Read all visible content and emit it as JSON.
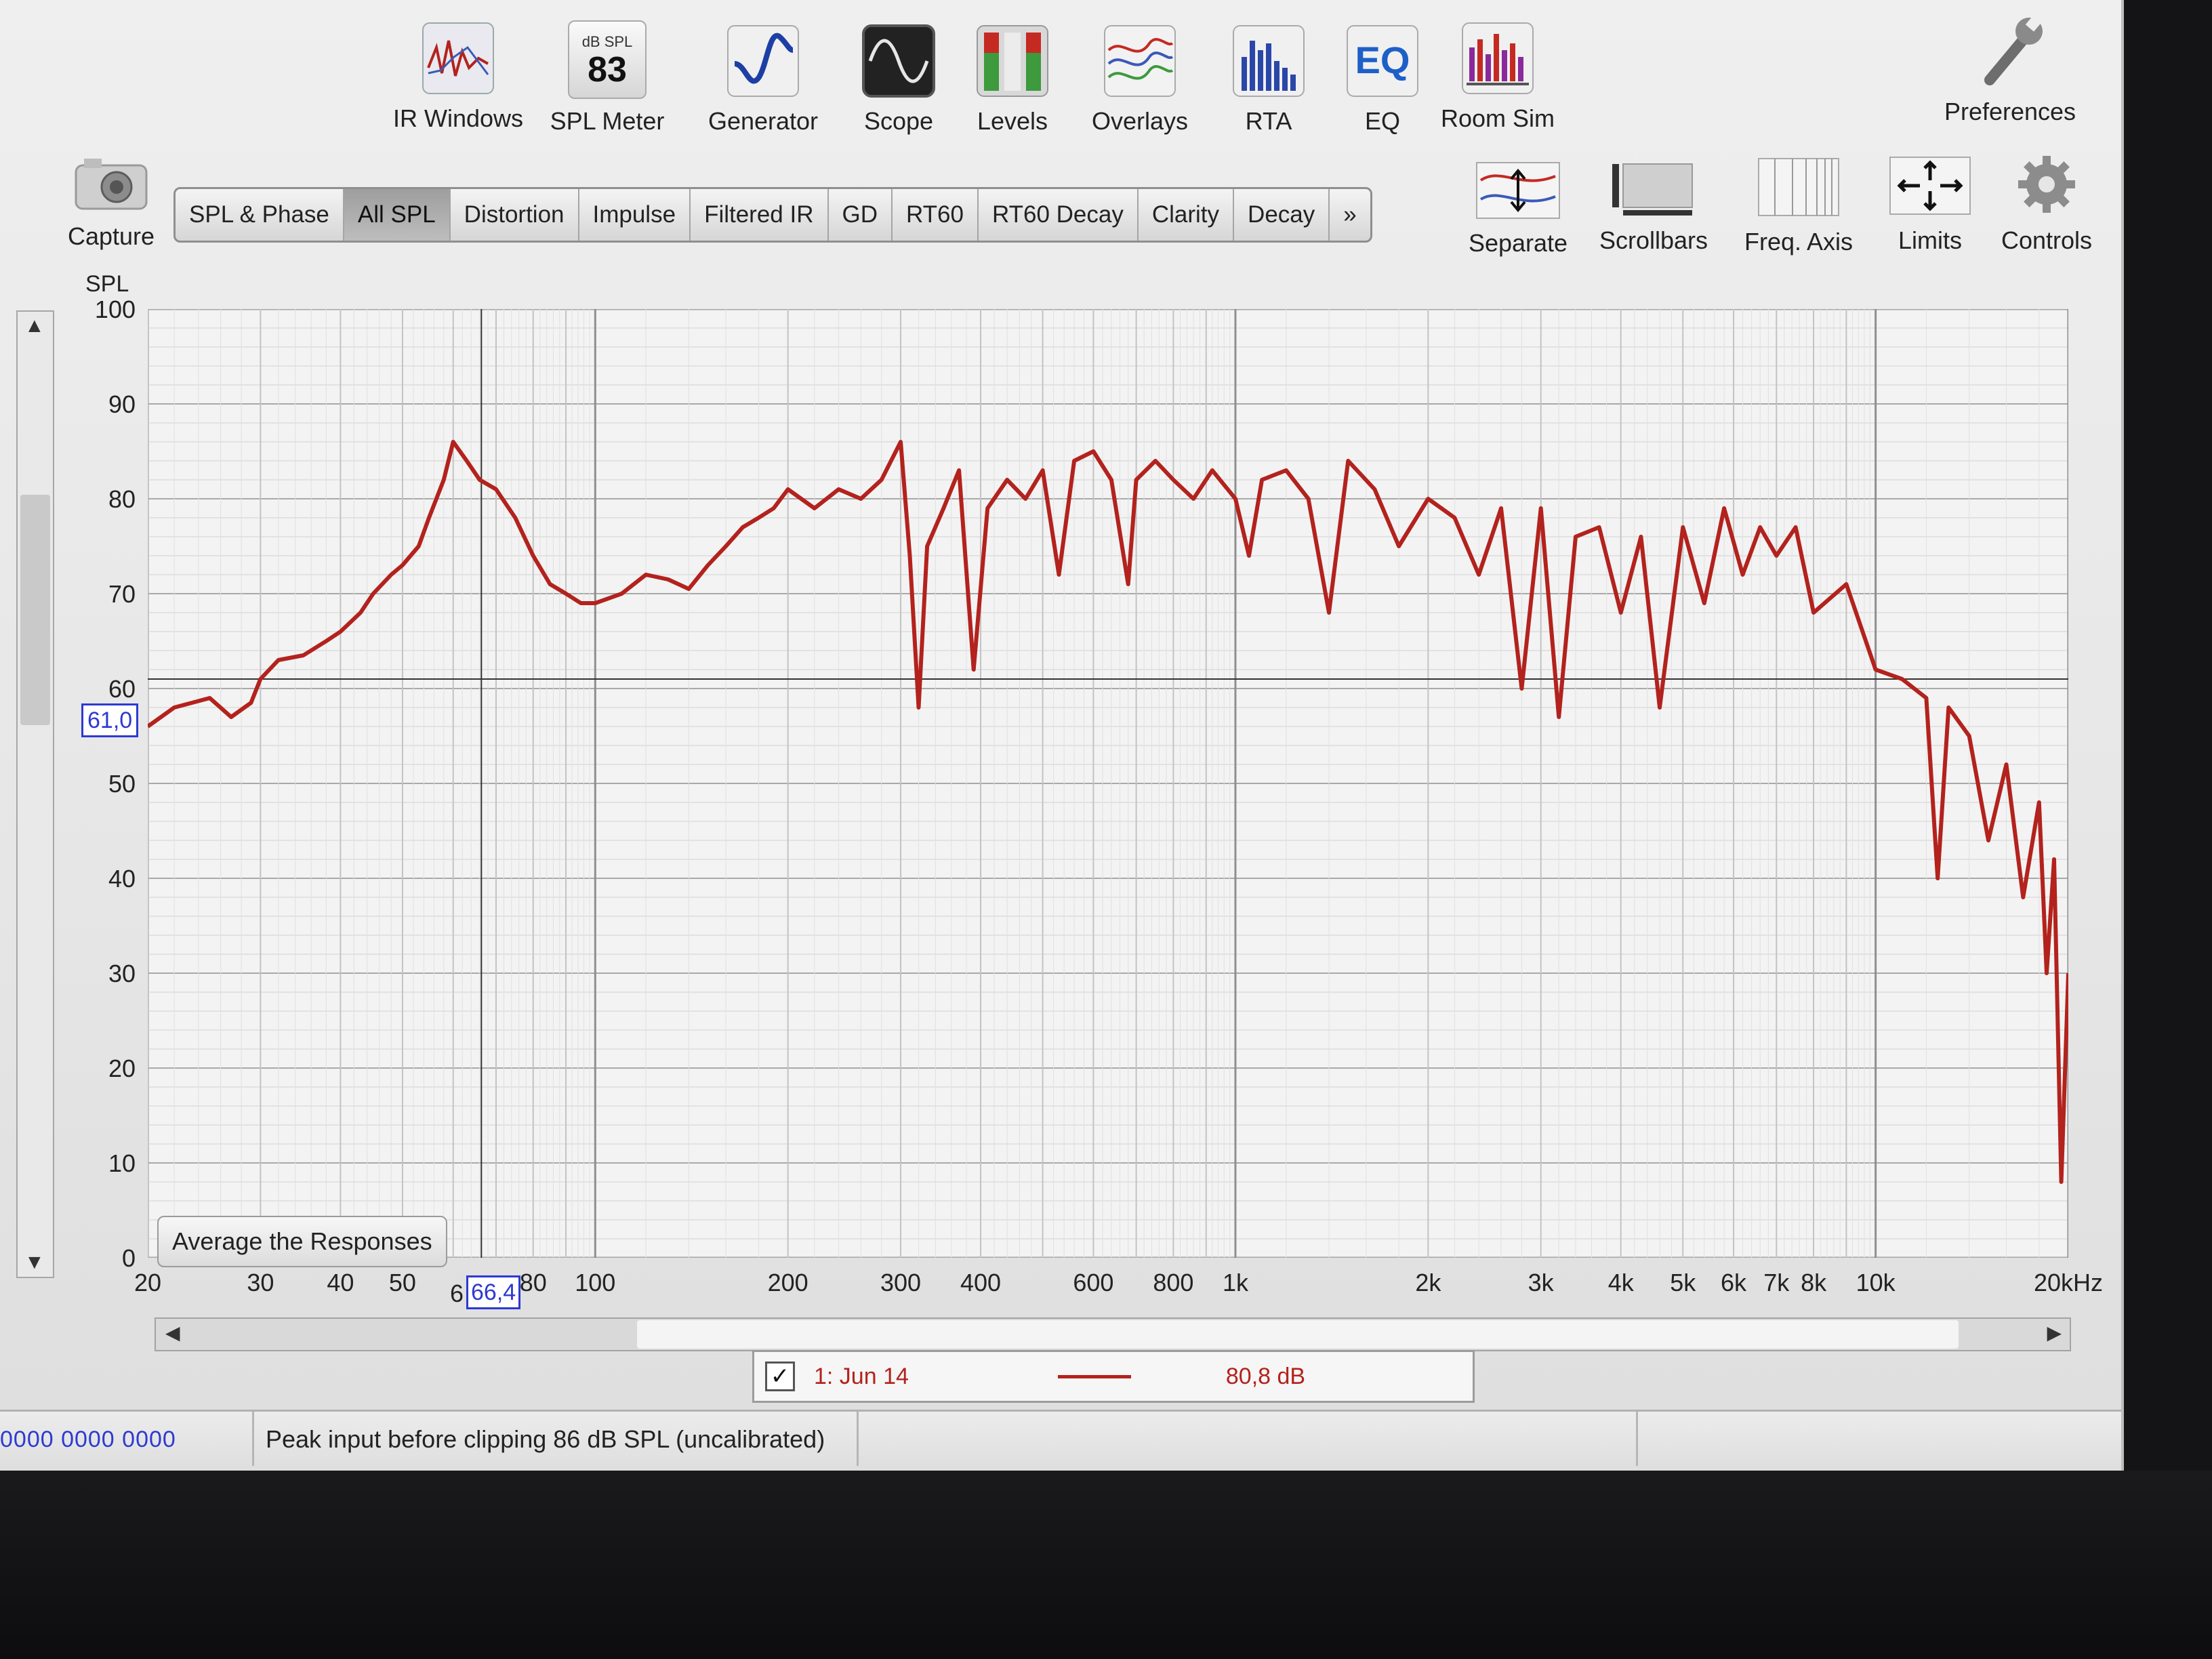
{
  "toolbar": {
    "items": [
      {
        "label": "IR Windows",
        "icon": "ir-windows-icon"
      },
      {
        "label": "SPL Meter",
        "icon": "spl-meter-icon",
        "badge_top": "dB SPL",
        "badge_value": "83"
      },
      {
        "label": "Generator",
        "icon": "generator-icon"
      },
      {
        "label": "Scope",
        "icon": "scope-icon"
      },
      {
        "label": "Levels",
        "icon": "levels-icon"
      },
      {
        "label": "Overlays",
        "icon": "overlays-icon"
      },
      {
        "label": "RTA",
        "icon": "rta-icon"
      },
      {
        "label": "EQ",
        "icon": "eq-icon"
      },
      {
        "label": "Room Sim",
        "icon": "room-sim-icon"
      }
    ],
    "preferences_label": "Preferences",
    "capture_label": "Capture",
    "right_tools": [
      "Separate",
      "Scrollbars",
      "Freq. Axis",
      "Limits",
      "Controls"
    ]
  },
  "tabs": [
    "SPL & Phase",
    "All SPL",
    "Distortion",
    "Impulse",
    "Filtered IR",
    "GD",
    "RT60",
    "RT60 Decay",
    "Clarity",
    "Decay",
    "»"
  ],
  "active_tab": "All SPL",
  "avg_button_label": "Average the Responses",
  "cursor": {
    "y_readout": "61,0",
    "x_readout": "66,4",
    "x_prefix": "6"
  },
  "legend": {
    "checked": "✓",
    "name": "1: Jun 14",
    "value": "80,8 dB"
  },
  "status": {
    "counters": "0000  0000 0000",
    "message": "Peak input before clipping 86 dB SPL (uncalibrated)"
  },
  "colors": {
    "trace": "#b3221d",
    "cursor_readout": "#2d3ad1",
    "grid": "#b9b9b9"
  },
  "chart_data": {
    "type": "line",
    "ylabel": "SPL",
    "xscale": "log",
    "xlim": [
      20,
      20000
    ],
    "ylim": [
      0,
      100
    ],
    "yticks": [
      "100",
      "90",
      "80",
      "70",
      "60",
      "50",
      "40",
      "30",
      "20",
      "10",
      "0"
    ],
    "xticks": [
      {
        "v": 20,
        "t": "20"
      },
      {
        "v": 30,
        "t": "30"
      },
      {
        "v": 40,
        "t": "40"
      },
      {
        "v": 50,
        "t": "50"
      },
      {
        "v": 80,
        "t": "80"
      },
      {
        "v": 100,
        "t": "100"
      },
      {
        "v": 200,
        "t": "200"
      },
      {
        "v": 300,
        "t": "300"
      },
      {
        "v": 400,
        "t": "400"
      },
      {
        "v": 600,
        "t": "600"
      },
      {
        "v": 800,
        "t": "800"
      },
      {
        "v": 1000,
        "t": "1k"
      },
      {
        "v": 2000,
        "t": "2k"
      },
      {
        "v": 3000,
        "t": "3k"
      },
      {
        "v": 4000,
        "t": "4k"
      },
      {
        "v": 5000,
        "t": "5k"
      },
      {
        "v": 6000,
        "t": "6k"
      },
      {
        "v": 7000,
        "t": "7k"
      },
      {
        "v": 8000,
        "t": "8k"
      },
      {
        "v": 10000,
        "t": "10k"
      },
      {
        "v": 20000,
        "t": "20kHz"
      }
    ],
    "cursor_x": 66.4,
    "cursor_y": 61.0,
    "series": [
      {
        "legend": "1: Jun 14",
        "points": [
          [
            20,
            56
          ],
          [
            22,
            58
          ],
          [
            25,
            59
          ],
          [
            27,
            57
          ],
          [
            29,
            58.5
          ],
          [
            30,
            61
          ],
          [
            32,
            63
          ],
          [
            35,
            63.5
          ],
          [
            38,
            65
          ],
          [
            40,
            66
          ],
          [
            43,
            68
          ],
          [
            45,
            70
          ],
          [
            48,
            72
          ],
          [
            50,
            73
          ],
          [
            53,
            75
          ],
          [
            55,
            78
          ],
          [
            58,
            82
          ],
          [
            60,
            86
          ],
          [
            63,
            84
          ],
          [
            66,
            82
          ],
          [
            70,
            81
          ],
          [
            75,
            78
          ],
          [
            80,
            74
          ],
          [
            85,
            71
          ],
          [
            90,
            70
          ],
          [
            95,
            69
          ],
          [
            100,
            69
          ],
          [
            110,
            70
          ],
          [
            120,
            72
          ],
          [
            130,
            71.5
          ],
          [
            140,
            70.5
          ],
          [
            150,
            73
          ],
          [
            160,
            75
          ],
          [
            170,
            77
          ],
          [
            180,
            78
          ],
          [
            190,
            79
          ],
          [
            200,
            81
          ],
          [
            220,
            79
          ],
          [
            240,
            81
          ],
          [
            260,
            80
          ],
          [
            280,
            82
          ],
          [
            300,
            86
          ],
          [
            310,
            74
          ],
          [
            320,
            58
          ],
          [
            330,
            75
          ],
          [
            350,
            79
          ],
          [
            370,
            83
          ],
          [
            390,
            62
          ],
          [
            410,
            79
          ],
          [
            440,
            82
          ],
          [
            470,
            80
          ],
          [
            500,
            83
          ],
          [
            530,
            72
          ],
          [
            560,
            84
          ],
          [
            600,
            85
          ],
          [
            640,
            82
          ],
          [
            680,
            71
          ],
          [
            700,
            82
          ],
          [
            750,
            84
          ],
          [
            800,
            82
          ],
          [
            860,
            80
          ],
          [
            920,
            83
          ],
          [
            1000,
            80
          ],
          [
            1050,
            74
          ],
          [
            1100,
            82
          ],
          [
            1200,
            83
          ],
          [
            1300,
            80
          ],
          [
            1400,
            68
          ],
          [
            1500,
            84
          ],
          [
            1650,
            81
          ],
          [
            1800,
            75
          ],
          [
            2000,
            80
          ],
          [
            2200,
            78
          ],
          [
            2400,
            72
          ],
          [
            2600,
            79
          ],
          [
            2800,
            60
          ],
          [
            3000,
            79
          ],
          [
            3200,
            57
          ],
          [
            3400,
            76
          ],
          [
            3700,
            77
          ],
          [
            4000,
            68
          ],
          [
            4300,
            76
          ],
          [
            4600,
            58
          ],
          [
            5000,
            77
          ],
          [
            5400,
            69
          ],
          [
            5800,
            79
          ],
          [
            6200,
            72
          ],
          [
            6600,
            77
          ],
          [
            7000,
            74
          ],
          [
            7500,
            77
          ],
          [
            8000,
            68
          ],
          [
            9000,
            71
          ],
          [
            10000,
            62
          ],
          [
            11000,
            61
          ],
          [
            12000,
            59
          ],
          [
            12500,
            40
          ],
          [
            13000,
            58
          ],
          [
            14000,
            55
          ],
          [
            15000,
            44
          ],
          [
            16000,
            52
          ],
          [
            17000,
            38
          ],
          [
            18000,
            48
          ],
          [
            18500,
            30
          ],
          [
            19000,
            42
          ],
          [
            19500,
            8
          ],
          [
            20000,
            30
          ]
        ]
      }
    ]
  }
}
